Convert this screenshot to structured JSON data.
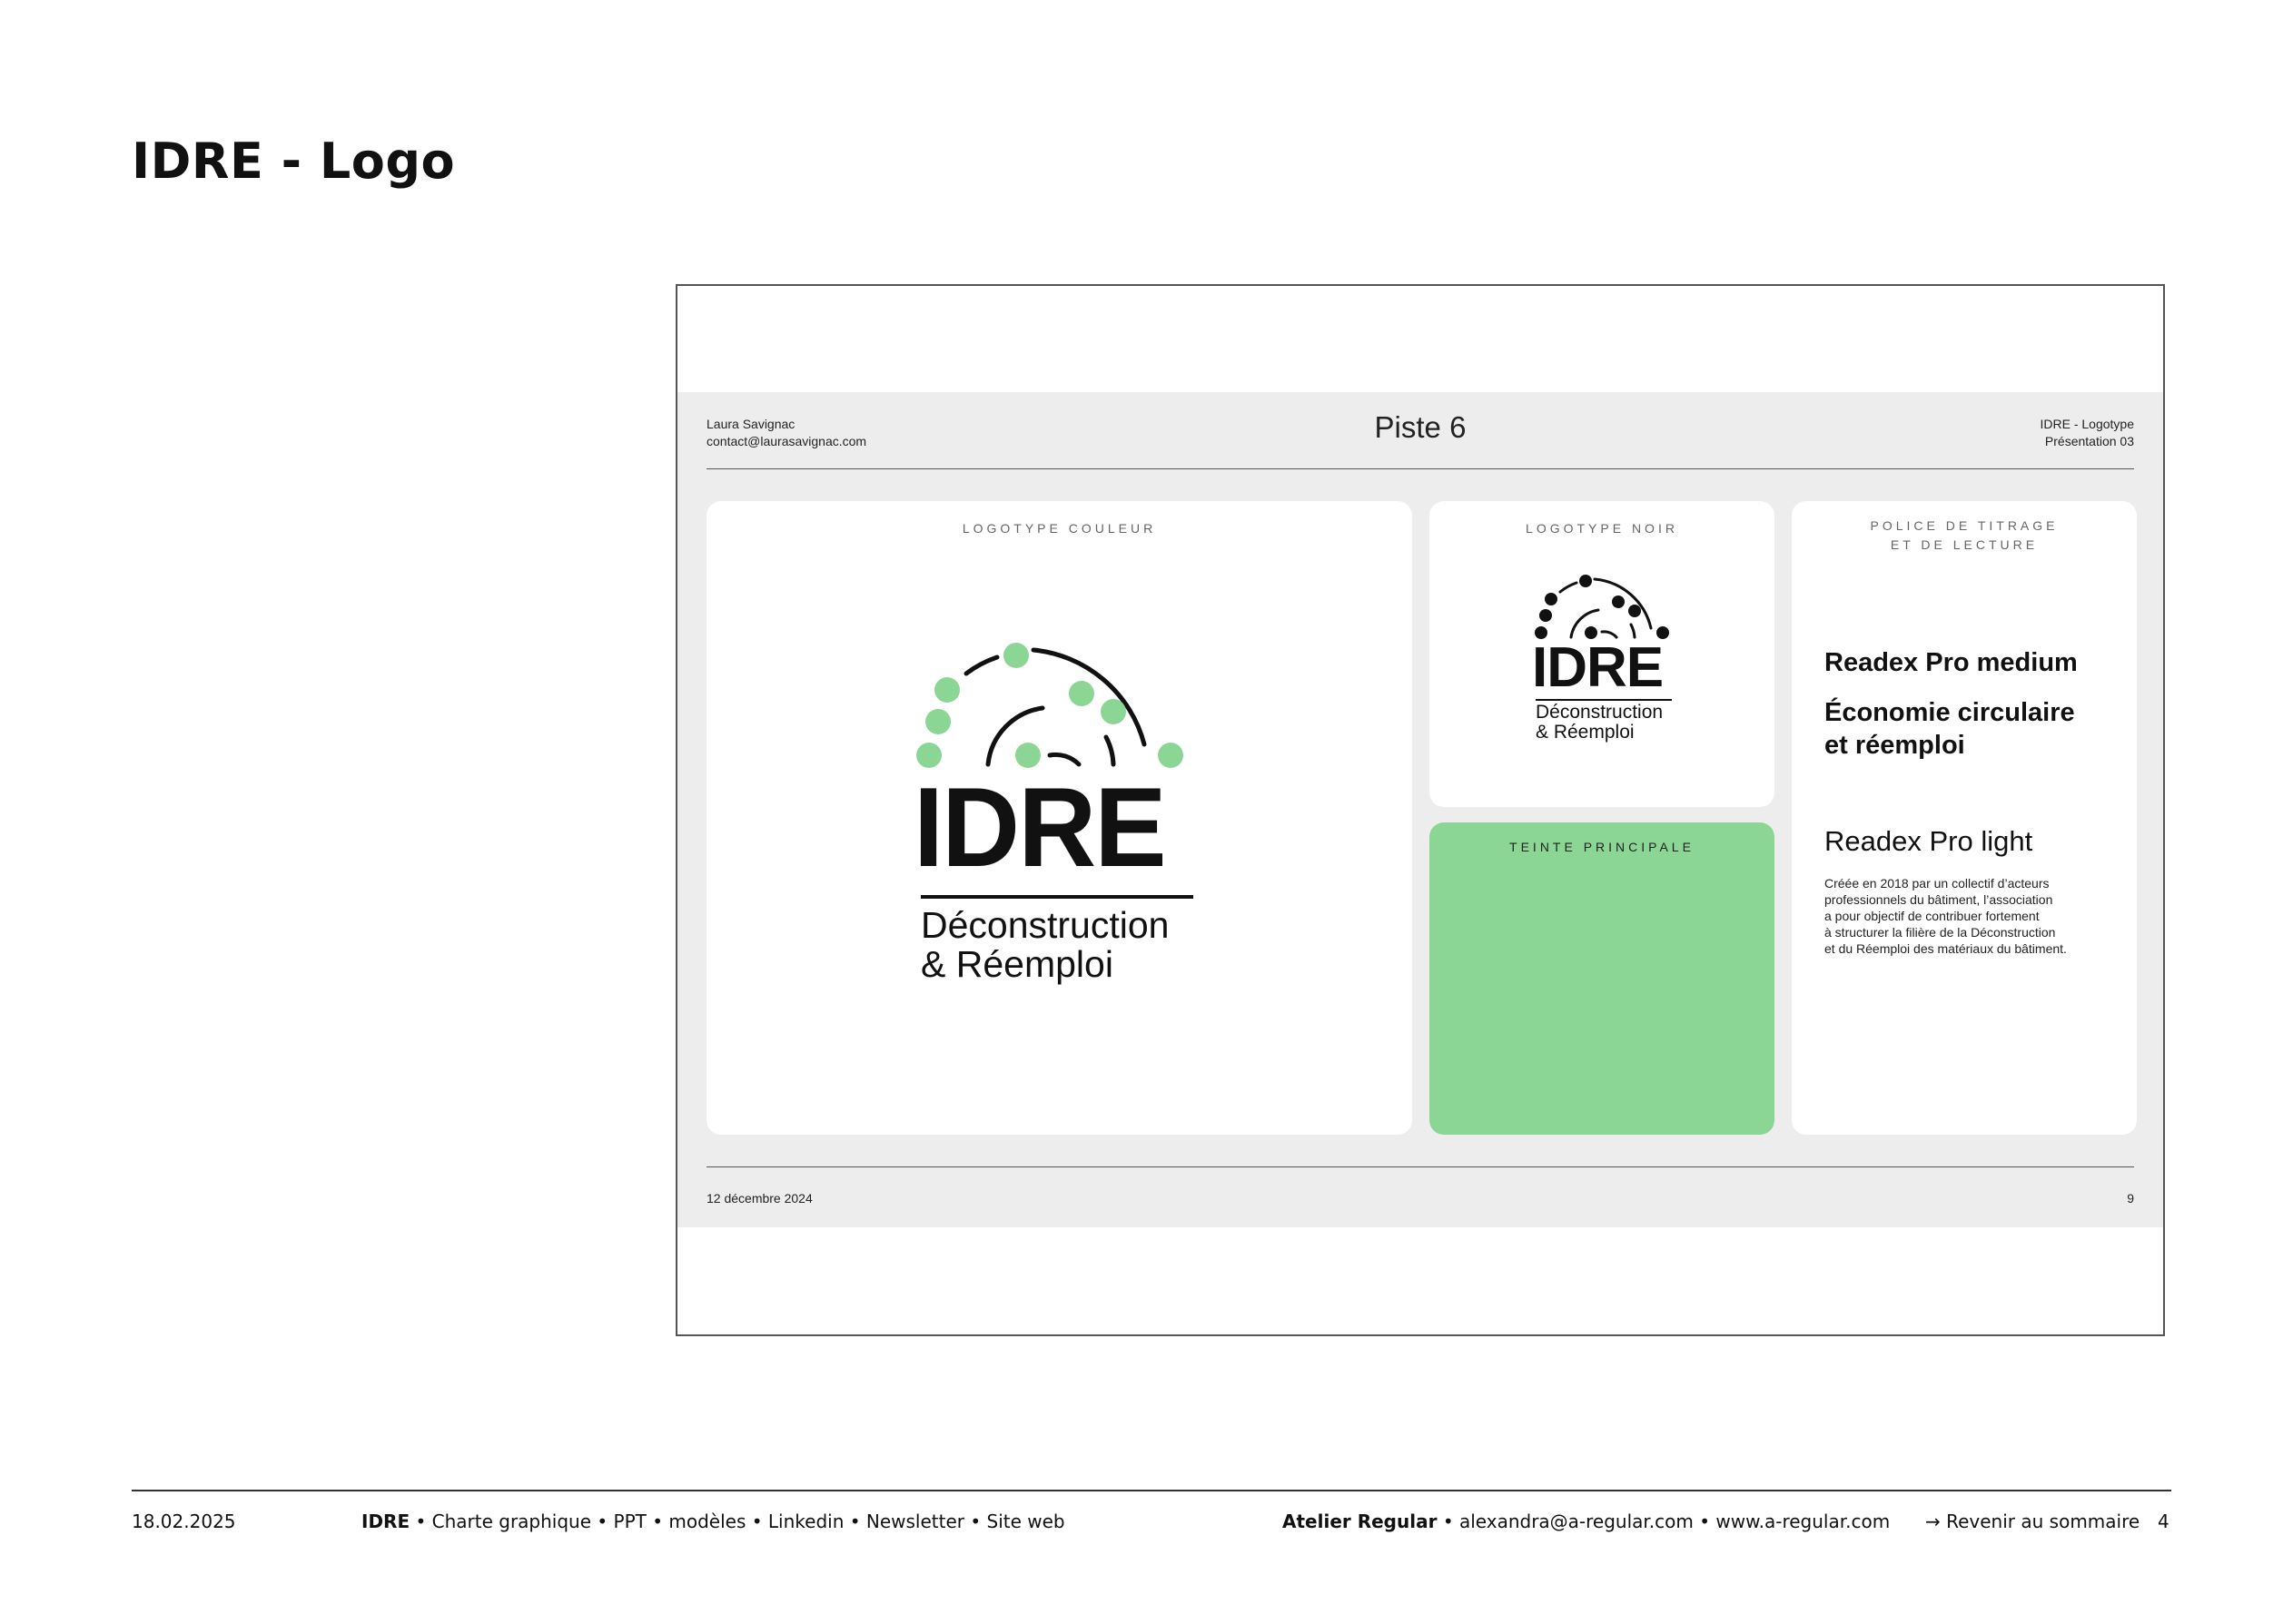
{
  "page": {
    "title": "IDRE - Logo"
  },
  "slide": {
    "author_name": "Laura Savignac",
    "author_email": "contact@laurasavignac.com",
    "title": "Piste 6",
    "ref_line1": "IDRE - Logotype",
    "ref_line2": "Présentation 03",
    "date": "12 décembre 2024",
    "page_number": "9",
    "cards": {
      "color_logo": {
        "label": "LOGOTYPE COULEUR",
        "wordmark": "IDRE",
        "sub1": "Déconstruction",
        "sub2": "& Réemploi",
        "accent": "#8cd695"
      },
      "black_logo": {
        "label": "LOGOTYPE NOIR",
        "wordmark": "IDRE",
        "sub1": "Déconstruction",
        "sub2": "& Réemploi"
      },
      "main_color": {
        "label": "TEINTE PRINCIPALE",
        "color": "#8cd695"
      },
      "fonts": {
        "label_line1": "POLICE DE TITRAGE",
        "label_line2": "ET DE LECTURE",
        "medium_name": "Readex Pro medium",
        "medium_sample_line1": "Économie circulaire",
        "medium_sample_line2": "et réemploi",
        "light_name": "Readex Pro light",
        "paragraph_lines": [
          "Créée en 2018 par un collectif d’acteurs",
          "professionnels du bâtiment, l’association",
          "a pour objectif de contribuer fortement",
          "à structurer la filière de la Déconstruction",
          "et du Réemploi des matériaux du bâtiment."
        ]
      }
    }
  },
  "footer": {
    "date": "18.02.2025",
    "brand": "IDRE",
    "items": "• Charte graphique • PPT • modèles • Linkedin • Newsletter • Site web",
    "studio": "Atelier Regular",
    "contact": "• alexandra@a-regular.com  • www.a-regular.com",
    "back_link": "→ Revenir au sommaire",
    "page_number": "4"
  }
}
